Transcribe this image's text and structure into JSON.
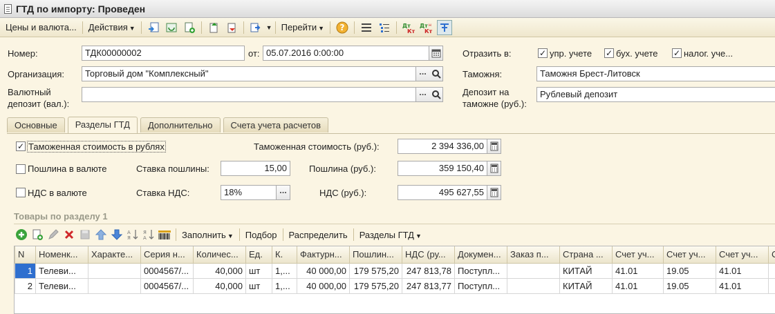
{
  "window": {
    "title": "ГТД по импорту: Проведен"
  },
  "toolbar": {
    "prices_currency": "Цены и валюта...",
    "actions": "Действия",
    "go": "Перейти"
  },
  "header": {
    "number_label": "Номер:",
    "number_value": "ТДК00000002",
    "date_label": "от:",
    "date_value": "05.07.2016  0:00:00",
    "org_label": "Организация:",
    "org_value": "Торговый дом \"Комплексный\"",
    "currency_deposit_label_1": "Валютный",
    "currency_deposit_label_2": "депозит (вал.):",
    "currency_deposit_value": "",
    "reflect_label": "Отразить в:",
    "reflect_mgmt": "упр. учете",
    "reflect_acc": "бух. учете",
    "reflect_tax": "налог. уче...",
    "customs_label": "Таможня:",
    "customs_value": "Таможня Брест-Литовск",
    "deposit_label_1": "Депозит на",
    "deposit_label_2": "таможне (руб.):",
    "deposit_value": "Рублевый депозит"
  },
  "tabs": [
    {
      "label": "Основные"
    },
    {
      "label": "Разделы ГТД"
    },
    {
      "label": "Дополнительно"
    },
    {
      "label": "Счета учета расчетов"
    }
  ],
  "section": {
    "customs_value_in_rub_chk": "Таможенная стоимость в рублях",
    "customs_value_label": "Таможенная стоимость (руб.):",
    "customs_value": "2 394 336,00",
    "duty_in_currency_chk": "Пошлина в валюте",
    "duty_rate_label": "Ставка пошлины:",
    "duty_rate_value": "15,00",
    "duty_label": "Пошлина (руб.):",
    "duty_value": "359 150,40",
    "vat_in_currency_chk": "НДС в валюте",
    "vat_rate_label": "Ставка НДС:",
    "vat_rate_value": "18%",
    "vat_label": "НДС (руб.):",
    "vat_value": "495 627,55"
  },
  "goods": {
    "title": "Товары по разделу 1",
    "fill": "Заполнить",
    "pick": "Подбор",
    "distribute": "Распределить",
    "sections": "Разделы ГТД",
    "columns": [
      "N",
      "Номенк...",
      "Характе...",
      "Серия н...",
      "Количес...",
      "Ед.",
      "К.",
      "Фактурн...",
      "Пошлин...",
      "НДС (ру...",
      "Докумен...",
      "Заказ п...",
      "Страна ...",
      "Счет уч...",
      "Счет уч...",
      "Счет уч...",
      "С"
    ],
    "rows": [
      [
        "1",
        "Телеви...",
        "",
        "0004567/...",
        "40,000",
        "шт",
        "1,...",
        "40 000,00",
        "179 575,20",
        "247 813,78",
        "Поступл...",
        "",
        "КИТАЙ",
        "41.01",
        "19.05",
        "41.01",
        ""
      ],
      [
        "2",
        "Телеви...",
        "",
        "0004567/...",
        "40,000",
        "шт",
        "1,...",
        "40 000,00",
        "179 575,20",
        "247 813,77",
        "Поступл...",
        "",
        "КИТАЙ",
        "41.01",
        "19.05",
        "41.01",
        ""
      ]
    ]
  }
}
